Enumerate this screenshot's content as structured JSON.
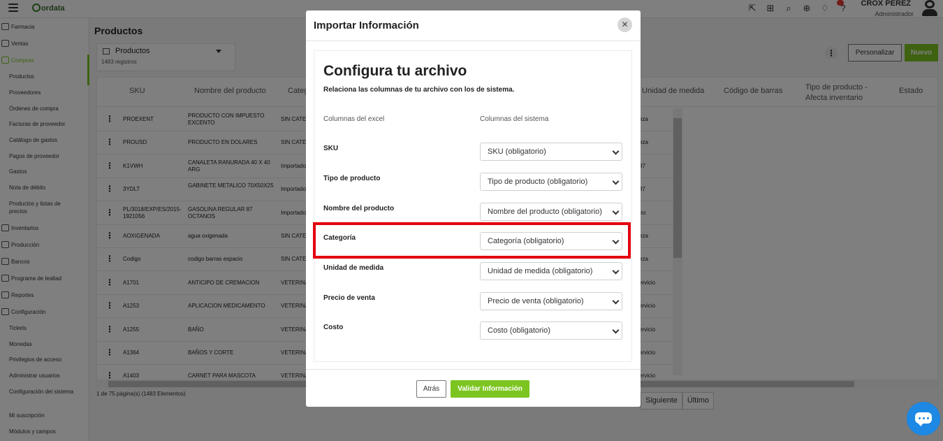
{
  "app": {
    "logo_text": "ordata"
  },
  "user": {
    "name": "CROX PEREZ",
    "role": "Administrador"
  },
  "sidebar": {
    "items": [
      {
        "label": "Farmacia",
        "type": "main"
      },
      {
        "label": "Ventas",
        "type": "main"
      },
      {
        "label": "Compras",
        "type": "main",
        "active": true
      },
      {
        "label": "Productos",
        "type": "sub"
      },
      {
        "label": "Proveedores",
        "type": "sub"
      },
      {
        "label": "Órdenes de compra",
        "type": "sub"
      },
      {
        "label": "Facturas de proveedor",
        "type": "sub"
      },
      {
        "label": "Catálogo de gastos",
        "type": "sub"
      },
      {
        "label": "Pagos de proveedor",
        "type": "sub"
      },
      {
        "label": "Gastos",
        "type": "sub"
      },
      {
        "label": "Nota de débito",
        "type": "sub"
      },
      {
        "label": "Productos y listas de precios",
        "type": "sub"
      },
      {
        "label": "Inventarios",
        "type": "main"
      },
      {
        "label": "Producción",
        "type": "main"
      },
      {
        "label": "Bancos",
        "type": "main"
      },
      {
        "label": "Programa de lealtad",
        "type": "main"
      },
      {
        "label": "Reportes",
        "type": "main"
      },
      {
        "label": "Configuración",
        "type": "main"
      },
      {
        "label": "Tickets",
        "type": "sub"
      },
      {
        "label": "Monedas",
        "type": "sub"
      },
      {
        "label": "Privilegios de acceso",
        "type": "sub"
      },
      {
        "label": "Administrar usuarios",
        "type": "sub"
      },
      {
        "label": "Configuración del sistema",
        "type": "sub"
      },
      {
        "label": "Mi suscripción",
        "type": "sub"
      },
      {
        "label": "Módulos y campos",
        "type": "sub"
      }
    ]
  },
  "main": {
    "title": "Productos",
    "view_label": "Productos",
    "record_count": "1483 registros",
    "personalizar_label": "Personalizar",
    "nuevo_label": "Nuevo",
    "columns": [
      "SKU",
      "Nombre del producto",
      "Catego",
      "Unidad de medida",
      "Código de barras",
      "Tipo de producto - Afecta inventario",
      "Estado"
    ],
    "rows": [
      {
        "sku": "PROEXENT",
        "name": "PRODUCTO CON IMPUESTO EXCENTO",
        "cat": "SIN CATE",
        "unit": "eza"
      },
      {
        "sku": "PROUSD",
        "name": "PRODUCTO EN DOLARES",
        "cat": "SIN CATE",
        "unit": "eza"
      },
      {
        "sku": "K1VWH",
        "name": "CANALETA RANURADA 40 X 40 ARG",
        "cat": "Importado",
        "unit": "87"
      },
      {
        "sku": "3YDLT",
        "name": "GABINETE METALICO 70X50X25",
        "cat": "Importado",
        "unit": "87"
      },
      {
        "sku": "PL/3018/EXP/ES/2015-1921056",
        "name": "GASOLINA REGULAR 87 OCTANOS",
        "cat": "Importado",
        "unit": "tro"
      },
      {
        "sku": "AOXIGENADA",
        "name": "agua oxigenada",
        "cat": "SIN CATE",
        "unit": "eza"
      },
      {
        "sku": "Codigo",
        "name": "codigo barras espacio",
        "cat": "SIN CATE",
        "unit": "eza"
      },
      {
        "sku": "A1701",
        "name": "ANTICIPO DE CREMACION",
        "cat": "VETERINA",
        "unit": "ervicio"
      },
      {
        "sku": "A1253",
        "name": "APLICACION MEDICAMENTO",
        "cat": "VETERINA",
        "unit": "ervicio"
      },
      {
        "sku": "A1255",
        "name": "BAÑO",
        "cat": "VETERINA",
        "unit": "ervicio"
      },
      {
        "sku": "A1364",
        "name": "BAÑOS Y CORTE",
        "cat": "VETERINA",
        "unit": "ervicio"
      },
      {
        "sku": "A1403",
        "name": "CARNET PARA MASCOTA",
        "cat": "VETERINA",
        "unit": "ervicio"
      }
    ],
    "pager_info": "1 de 75 página(s) (1483 Elementos)",
    "pager_next": "Siguiente",
    "pager_last": "Último"
  },
  "modal": {
    "title": "Importar Información",
    "heading": "Configura tu archivo",
    "subheading": "Relaciona las columnas de tu archivo con los de sistema.",
    "col_excel": "Columnas del excel",
    "col_system": "Columnas del sistema",
    "fields": [
      {
        "label": "SKU",
        "value": "SKU (obligatorio)"
      },
      {
        "label": "Tipo de producto",
        "value": "Tipo de producto (obligatorio)"
      },
      {
        "label": "Nombre del producto",
        "value": "Nombre del producto (obligatorio)"
      },
      {
        "label": "Categoría",
        "value": "Categoría (obligatorio)"
      },
      {
        "label": "Unidad de medida",
        "value": "Unidad de medida (obligatorio)"
      },
      {
        "label": "Precio de venta",
        "value": "Precio de venta (obligatorio)"
      },
      {
        "label": "Costo",
        "value": "Costo (obligatorio)"
      }
    ],
    "back_label": "Atrás",
    "validate_label": "Validar Información"
  },
  "colors": {
    "accent": "#7cc520",
    "highlight": "#e3000f",
    "chat": "#1e88e5"
  }
}
